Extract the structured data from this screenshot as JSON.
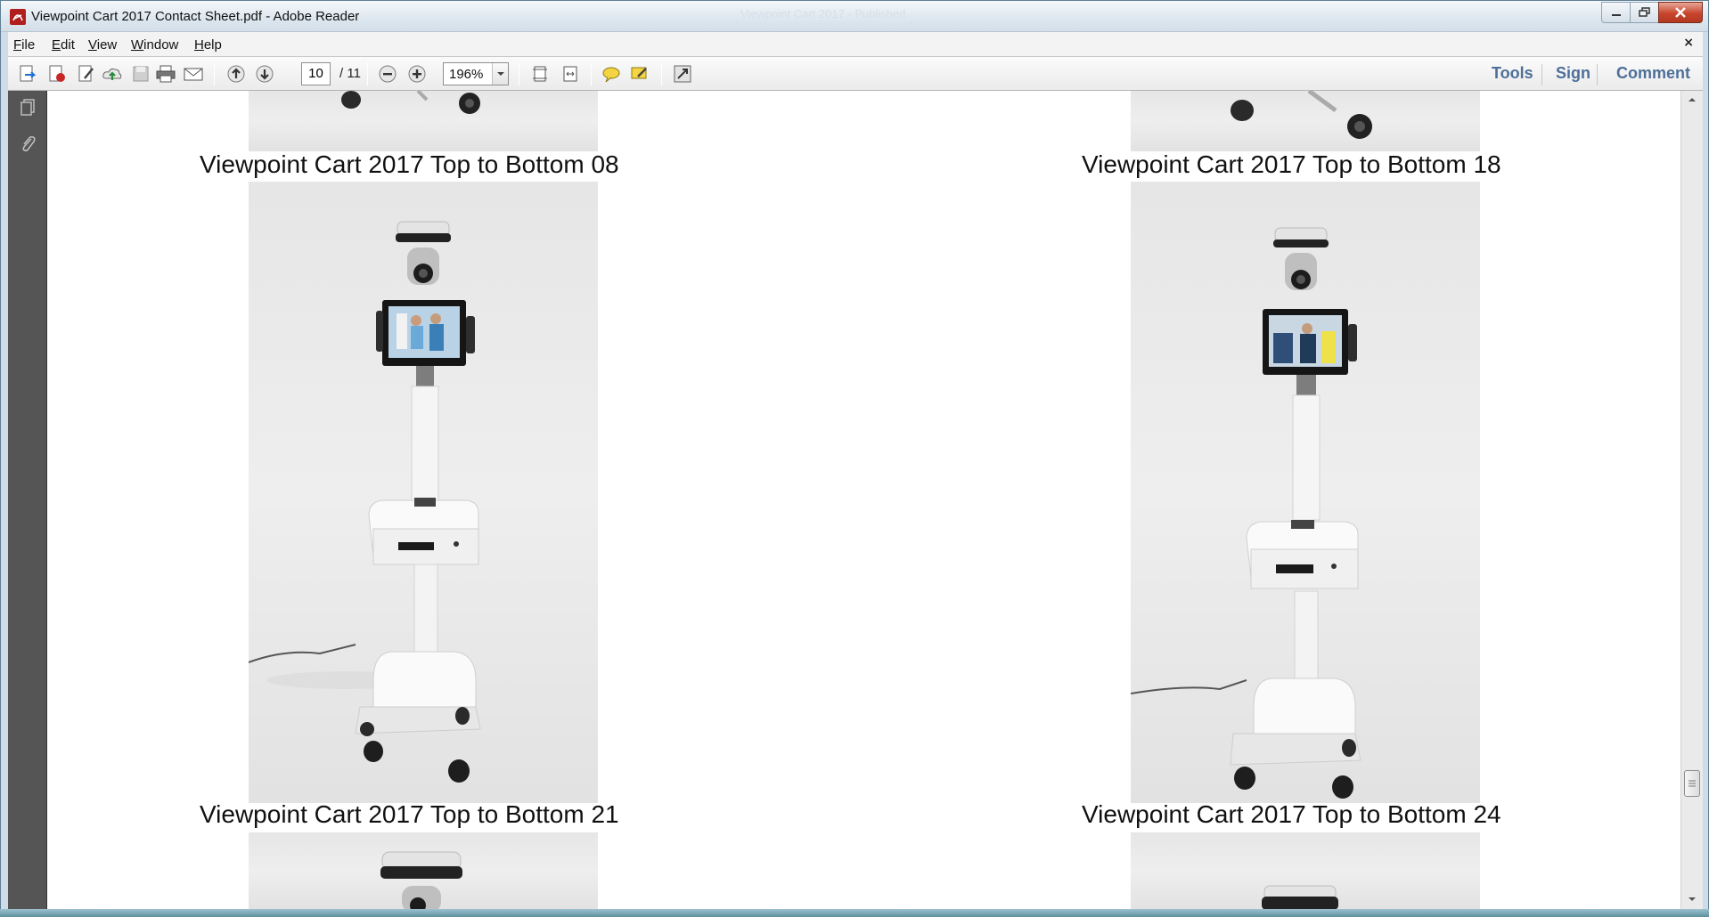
{
  "window": {
    "title": "Viewpoint Cart 2017 Contact Sheet.pdf - Adobe Reader",
    "ghost_title": "Viewpoint Cart 2017 - Published"
  },
  "menu": {
    "items": [
      {
        "label": "File",
        "accel": "F",
        "rest": "ile"
      },
      {
        "label": "Edit",
        "accel": "E",
        "rest": "dit"
      },
      {
        "label": "View",
        "accel": "V",
        "rest": "iew"
      },
      {
        "label": "Window",
        "accel": "W",
        "rest": "indow"
      },
      {
        "label": "Help",
        "accel": "H",
        "rest": "elp"
      }
    ],
    "close_glyph": "×"
  },
  "toolbar": {
    "current_page": "10",
    "page_total": "/ 11",
    "zoom": "196%",
    "links": {
      "tools": "Tools",
      "sign": "Sign",
      "comment": "Comment"
    }
  },
  "document": {
    "captions": {
      "top_left": "Viewpoint Cart 2017 Top to Bottom 08",
      "top_right": "Viewpoint Cart 2017 Top to Bottom 18",
      "bottom_left": "Viewpoint Cart 2017 Top to Bottom 21",
      "bottom_right": "Viewpoint Cart 2017 Top to Bottom 24"
    },
    "photo_subject": "telemedicine cart with camera and tablet"
  },
  "icons": {
    "open": "open-file-icon",
    "create": "create-pdf-icon",
    "edit": "edit-pdf-icon",
    "cloud": "cloud-upload-icon",
    "save": "save-icon",
    "print": "print-icon",
    "email": "email-icon",
    "prev": "previous-page-icon",
    "next": "next-page-icon",
    "zoom_out": "zoom-out-icon",
    "zoom_in": "zoom-in-icon",
    "fit_page": "fit-page-icon",
    "fit_width": "fit-width-icon",
    "comment": "sticky-note-icon",
    "highlight": "highlight-icon",
    "fullscreen": "fullscreen-icon",
    "pages": "pages-panel-icon",
    "attach": "attachments-icon"
  },
  "colors": {
    "link": "#4d6f99",
    "nav_pane": "#555555",
    "close_button": "#c8442d"
  }
}
